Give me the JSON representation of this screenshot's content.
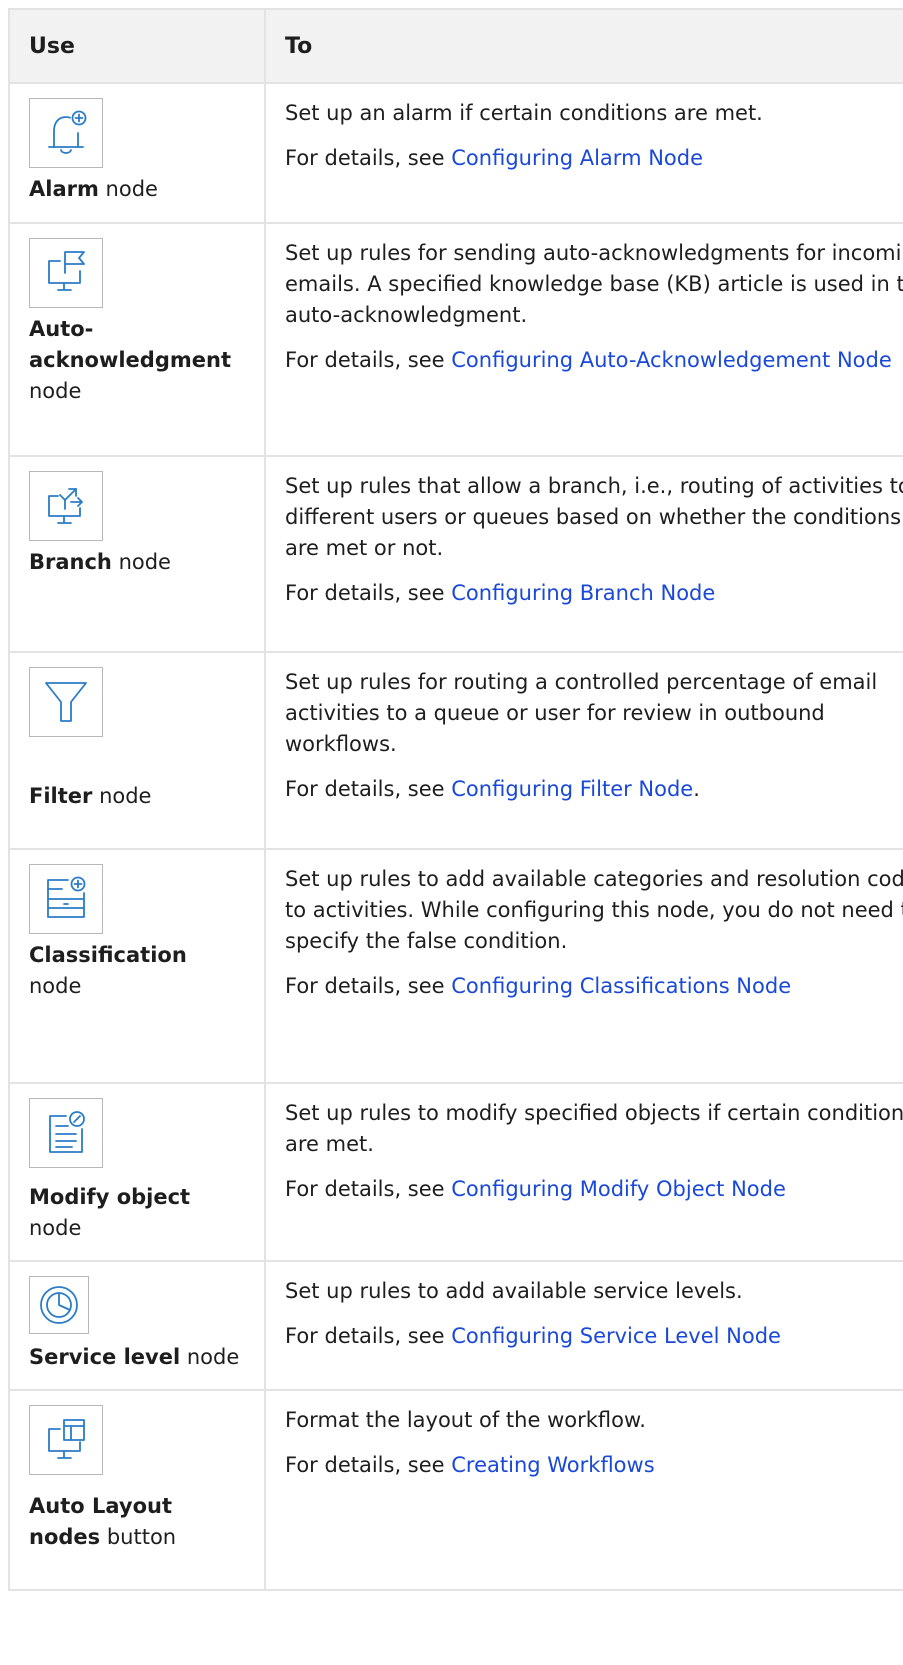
{
  "header": {
    "use": "Use",
    "to": "To"
  },
  "details_prefix": "For details, see ",
  "accent_color": "#2a7cc7",
  "link_color": "#1a48d8",
  "rows": [
    {
      "icon": "alarm-bell-plus-icon",
      "name_bold": "Alarm",
      "name_rest": " node",
      "description": "Set up an alarm if certain conditions are met.",
      "link": "Configuring Alarm Node",
      "link_suffix": ""
    },
    {
      "icon": "monitor-flag-icon",
      "name_bold": "Auto-acknowledgment",
      "name_rest": " node",
      "description": "Set up rules for sending auto-acknowledgments for incoming emails. A specified knowledge base (KB) article is used in the auto-acknowledgment.",
      "link": "Configuring Auto-Acknowledgement Node",
      "link_suffix": ""
    },
    {
      "icon": "monitor-branch-arrow-icon",
      "name_bold": "Branch",
      "name_rest": " node",
      "description": "Set up rules that allow a branch, i.e., routing of activities to different users or queues based on whether the conditions are met or not.",
      "link": "Configuring Branch Node",
      "link_suffix": ""
    },
    {
      "icon": "funnel-filter-icon",
      "name_bold": "Filter",
      "name_rest": " node",
      "description": "Set up rules for routing a controlled percentage of email activities to a queue or user for review in outbound workflows.",
      "link": "Configuring Filter Node",
      "link_suffix": "."
    },
    {
      "icon": "list-plus-icon",
      "name_bold": "Classification",
      "name_rest": " node",
      "description": "Set up rules to add available categories and resolution codes to activities. While configuring this node, you do not need to specify the false condition.",
      "link": "Configuring Classifications Node",
      "link_suffix": ""
    },
    {
      "icon": "document-edit-icon",
      "name_bold": "Modify object",
      "name_rest": " node",
      "description": "Set up rules  to modify specified objects if certain conditions are met.",
      "link": "Configuring Modify Object Node",
      "link_suffix": ""
    },
    {
      "icon": "pie-gauge-icon",
      "name_bold": "Service level",
      "name_rest": " node",
      "description": "Set up rules to add available service levels.",
      "link": "Configuring Service Level Node",
      "link_suffix": ""
    },
    {
      "icon": "monitor-layout-icon",
      "name_bold": "Auto Layout nodes",
      "name_rest": " button",
      "description": "Format the layout of the workflow.",
      "link": "Creating Workflows",
      "link_suffix": ""
    }
  ]
}
